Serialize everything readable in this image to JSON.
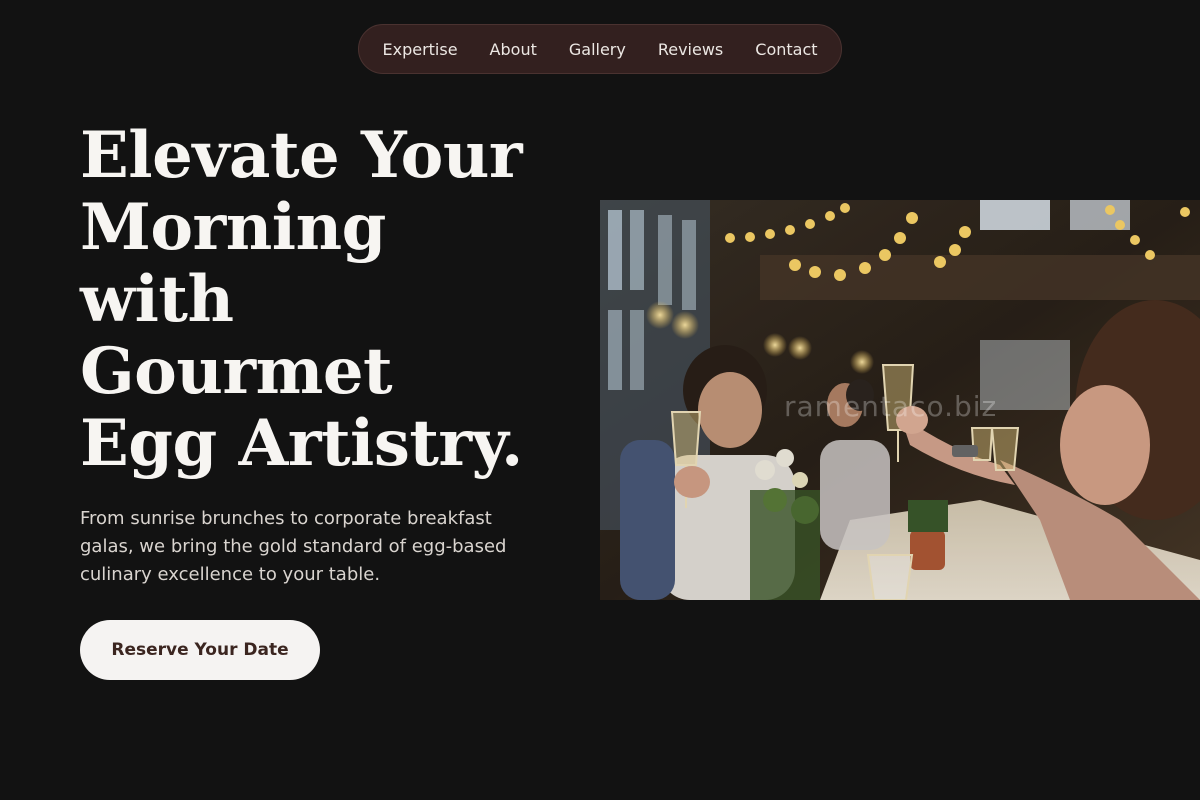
{
  "nav": {
    "items": [
      {
        "label": "Expertise"
      },
      {
        "label": "About"
      },
      {
        "label": "Gallery"
      },
      {
        "label": "Reviews"
      },
      {
        "label": "Contact"
      }
    ]
  },
  "hero": {
    "title": "Elevate Your Morning with Gourmet Egg Artistry.",
    "subtitle": "From sunrise brunches to corporate breakfast galas, we bring the gold standard of egg-based culinary excellence to your table.",
    "cta_label": "Reserve Your Date"
  },
  "image": {
    "watermark": "ramentaco.biz"
  },
  "colors": {
    "background": "#121212",
    "nav_bg": "#33201f",
    "cta_bg": "#f5f3f2",
    "cta_text": "#3b2520"
  }
}
